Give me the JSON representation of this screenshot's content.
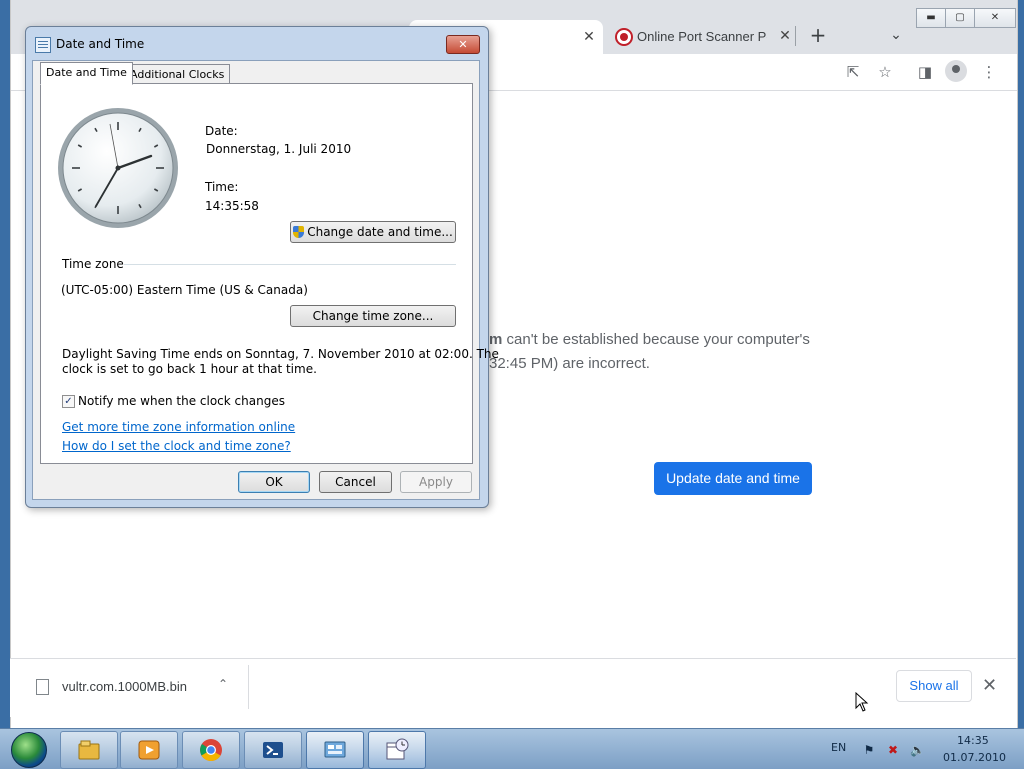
{
  "browser": {
    "tabs": [
      {
        "title": "",
        "active": true
      },
      {
        "title": "Online Port Scanner Pov",
        "active": false
      }
    ],
    "window_controls": {
      "minimize": "▬",
      "maximize": "▢",
      "close": "✕"
    },
    "toolbar_icons": [
      "share-icon",
      "star-icon",
      "sidepanel-icon",
      "profile-icon",
      "menu-icon"
    ]
  },
  "page": {
    "error_line1_bold": "m",
    "error_line1_rest": " can't be established because your computer's",
    "error_line2": "32:45 PM) are incorrect.",
    "update_button": "Update date and time"
  },
  "downloads": {
    "filename": "vultr.com.1000MB.bin",
    "show_all": "Show all"
  },
  "dialog": {
    "title": "Date and Time",
    "tabs": [
      "Date and Time",
      "Additional Clocks"
    ],
    "date_label": "Date:",
    "date_value": "Donnerstag, 1. Juli 2010",
    "time_label": "Time:",
    "time_value": "14:35:58",
    "change_datetime_button": "Change date and time...",
    "timezone_header": "Time zone",
    "timezone_value": "(UTC-05:00) Eastern Time (US & Canada)",
    "change_timezone_button": "Change time zone...",
    "dst_line1": "Daylight Saving Time ends on Sonntag, 7. November 2010 at 02:00. The",
    "dst_line2": "clock is set to go back 1 hour at that time.",
    "notify_label": "Notify me when the clock changes",
    "notify_checked": true,
    "link_more_info": "Get more time zone information online",
    "link_how_to": "How do I set the clock and time zone?",
    "ok": "OK",
    "cancel": "Cancel",
    "apply": "Apply"
  },
  "taskbar": {
    "apps": [
      "explorer-icon",
      "media-player-icon",
      "chrome-icon",
      "powershell-icon",
      "control-panel-icon",
      "date-time-icon"
    ],
    "language": "EN",
    "clock_time": "14:35",
    "clock_date": "01.07.2010"
  }
}
